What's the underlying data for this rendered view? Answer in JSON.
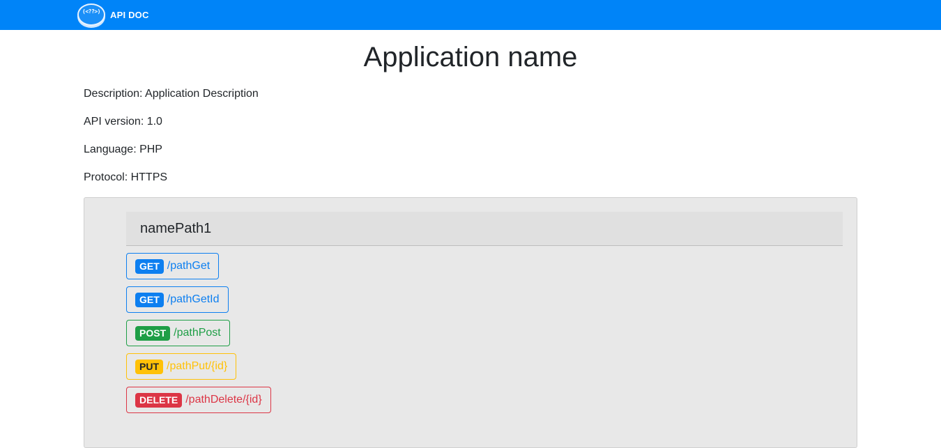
{
  "navbar": {
    "logo_glyph": "(<??>)",
    "brand": "API DOC",
    "color": "#0084f8"
  },
  "page": {
    "title": "Application name",
    "description": "Description: Application Description",
    "version": "API version: 1.0",
    "language": "Language: PHP",
    "protocol": "Protocol: HTTPS"
  },
  "section": {
    "title": "namePath1",
    "endpoints": [
      {
        "method": "GET",
        "path": "/pathGet",
        "color": "#0d7ff0"
      },
      {
        "method": "GET",
        "path": "/pathGetId",
        "color": "#0d7ff0"
      },
      {
        "method": "POST",
        "path": "/pathPost",
        "color": "#1e9e46"
      },
      {
        "method": "PUT",
        "path": "/pathPut/{id}",
        "color": "#ffc107"
      },
      {
        "method": "DELETE",
        "path": "/pathDelete/{id}",
        "color": "#dc3545"
      }
    ]
  }
}
